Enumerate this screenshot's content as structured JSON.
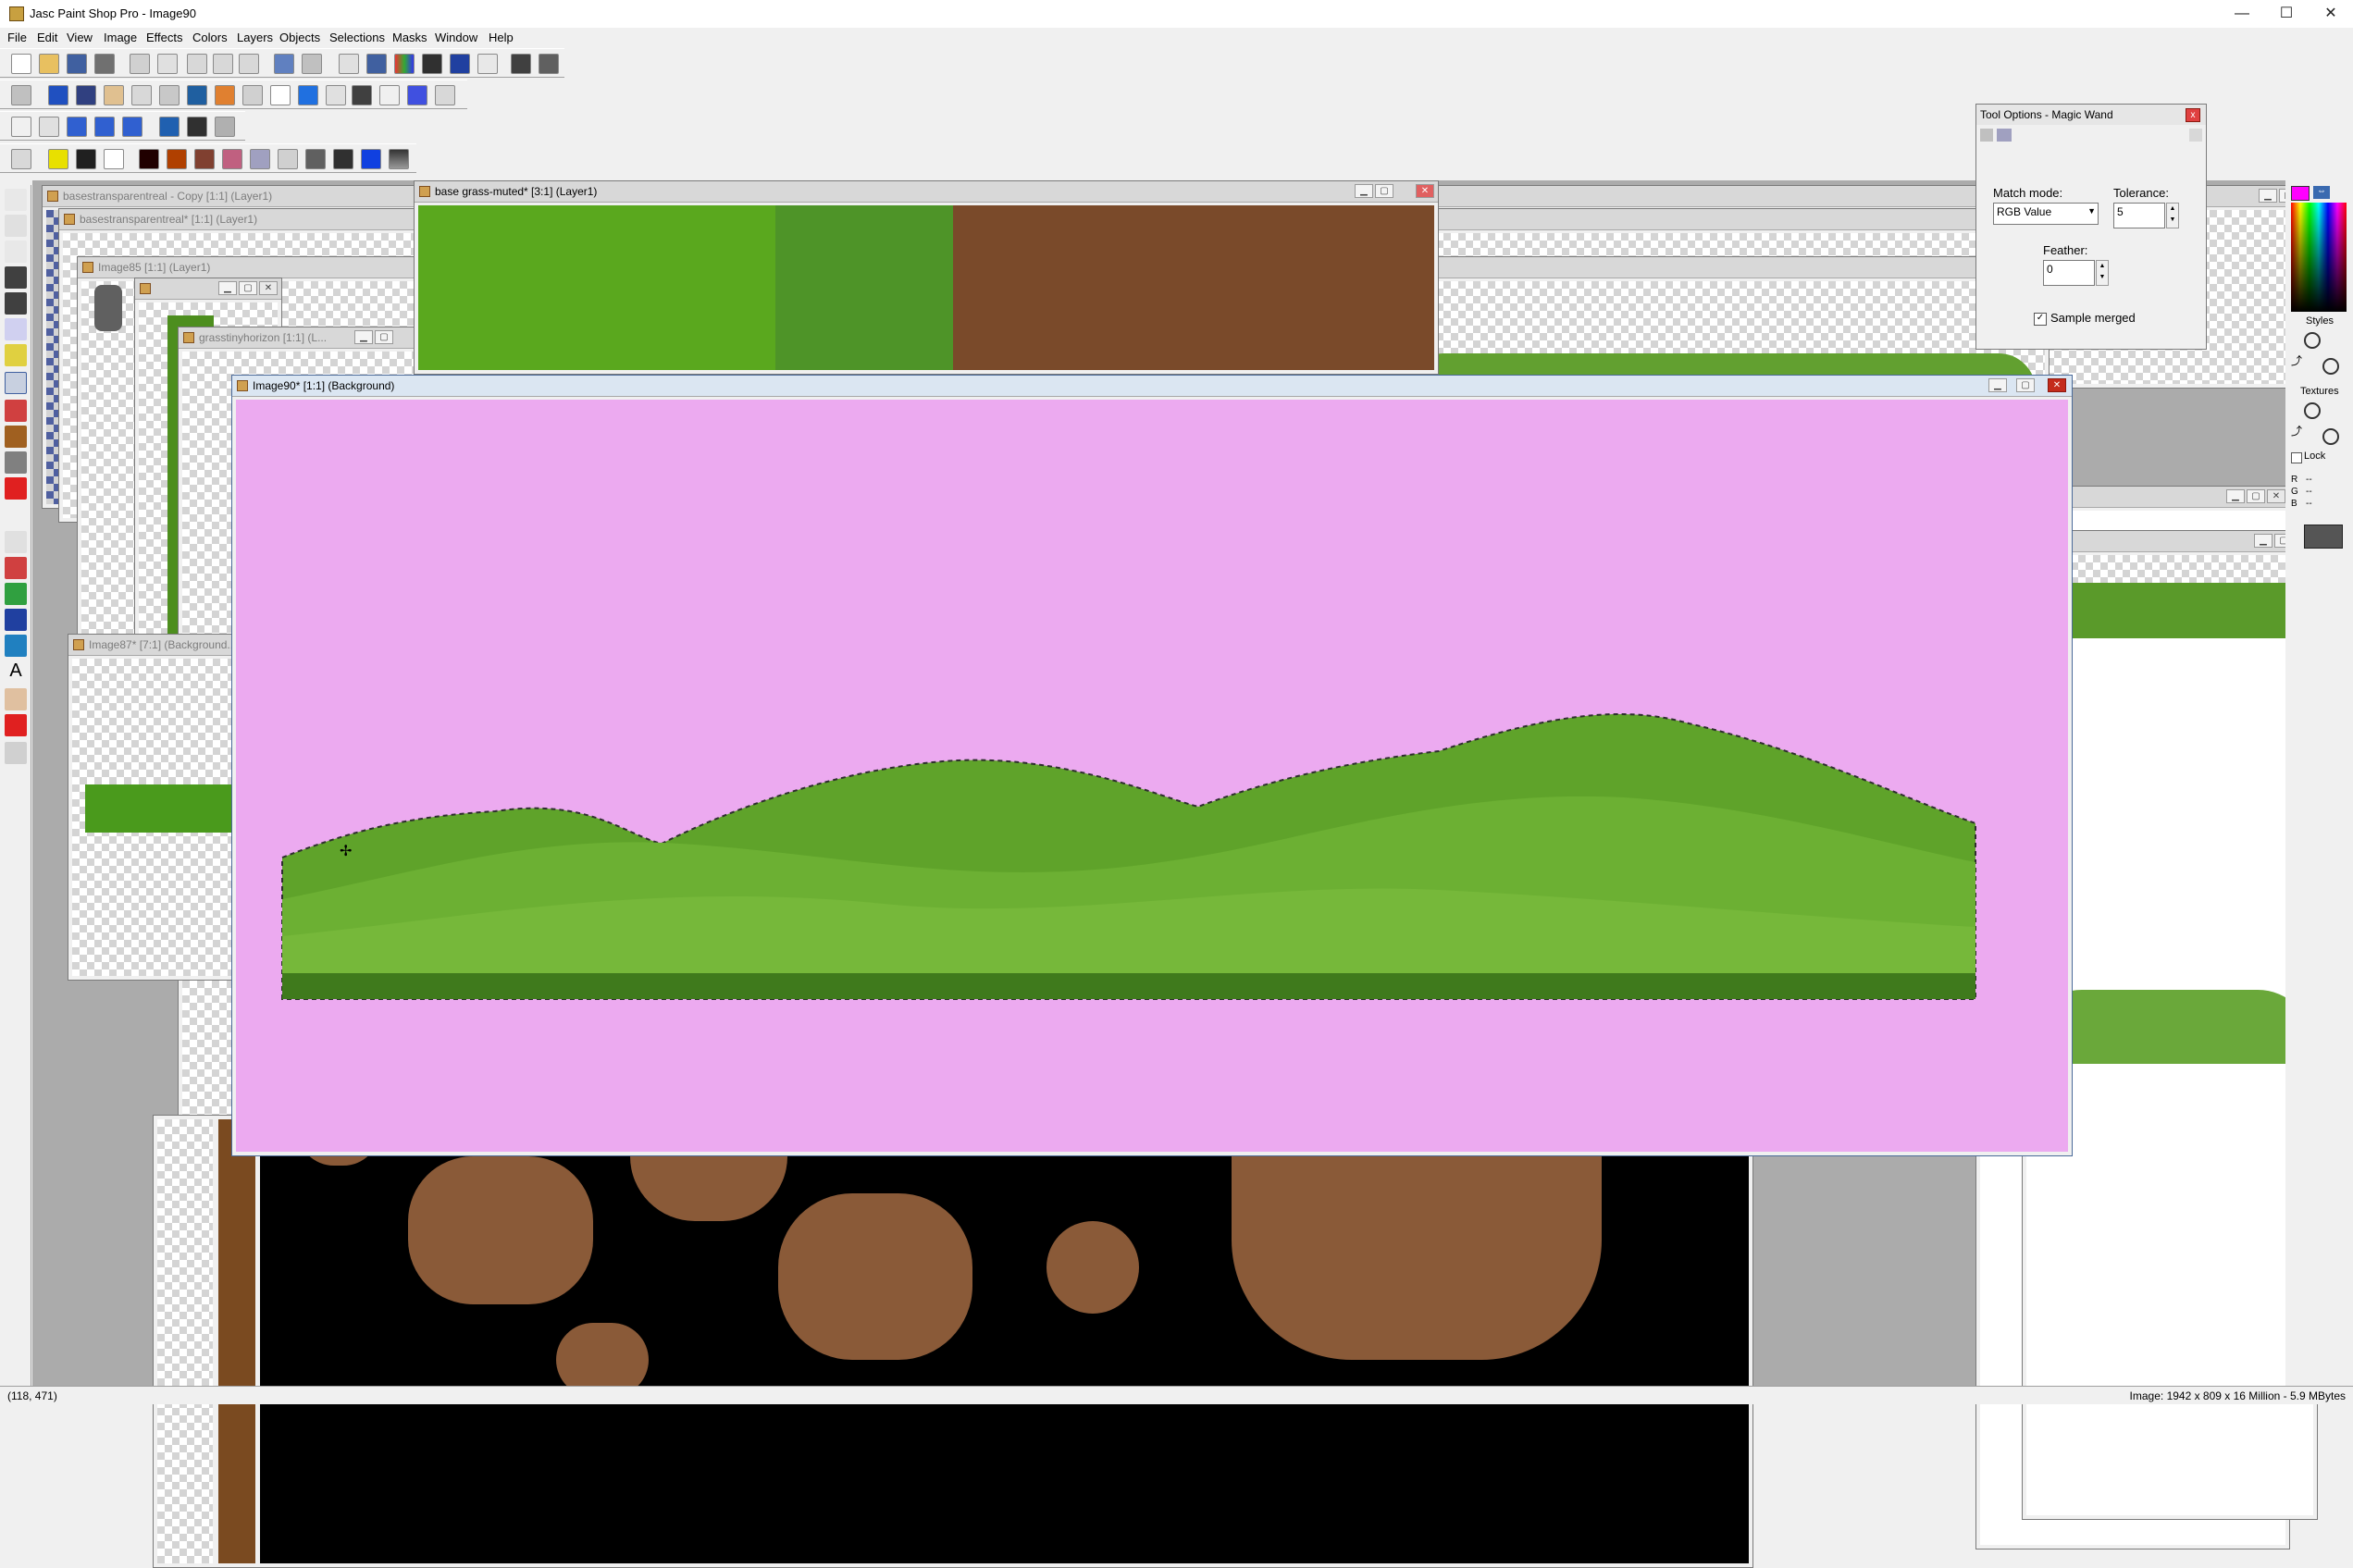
{
  "app": {
    "title": "Jasc Paint Shop Pro - Image90",
    "minimize": "—",
    "maximize": "☐",
    "close": "✕"
  },
  "menu": [
    "File",
    "Edit",
    "View",
    "Image",
    "Effects",
    "Colors",
    "Layers",
    "Objects",
    "Selections",
    "Masks",
    "Window",
    "Help"
  ],
  "documents": {
    "basecopy": "basestransparentreal - Copy [1:1] (Layer1)",
    "basestrans": "basestransparentreal* [1:1] (Layer1)",
    "image85": "Image85 [1:1] (Layer1)",
    "grasstiny": "grasstinyhorizon [1:1] (L...",
    "image87": "Image87* [7:1] (Background...",
    "basegrass": "base grass-muted* [3:1] (Layer1)",
    "image90": "Image90* [1:1] (Background)"
  },
  "tool_options": {
    "title": "Tool Options - Magic Wand",
    "close": "x",
    "match_mode_label": "Match mode:",
    "match_mode_value": "RGB Value",
    "tolerance_label": "Tolerance:",
    "tolerance_value": "5",
    "feather_label": "Feather:",
    "feather_value": "0",
    "sample_merged_label": "Sample merged",
    "sample_merged_checked": true
  },
  "palette": {
    "styles_label": "Styles",
    "textures_label": "Textures",
    "lock_label": "Lock",
    "r_label": "R",
    "g_label": "G",
    "b_label": "B",
    "dash": "--",
    "foreground_color": "#ff00ff",
    "background_color": "#ffffff"
  },
  "status": {
    "coords": "(118, 471)",
    "image_info": "Image: 1942 x 809 x 16 Million - 5.9 MBytes"
  },
  "colors": {
    "canvas_pink": "#ecaaf0",
    "grass_green": "#5aa81e",
    "dirt_brown": "#7a4a2a"
  }
}
